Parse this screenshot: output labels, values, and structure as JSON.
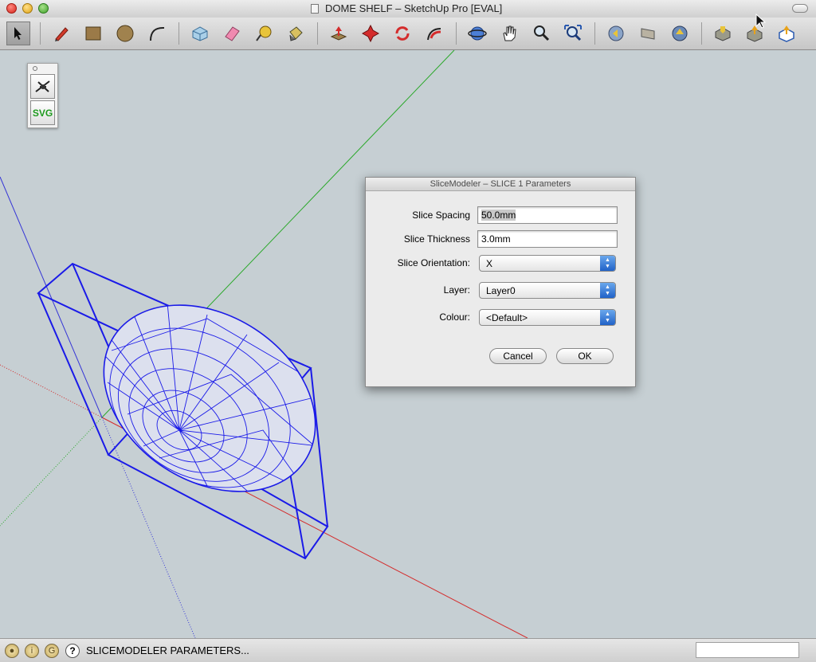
{
  "window": {
    "title": "DOME SHELF – SketchUp Pro [EVAL]"
  },
  "toolbar": {
    "tools": [
      "select",
      "pencil",
      "rectangle",
      "circle",
      "arc",
      "make-component",
      "eraser",
      "tape-measure",
      "paint-bucket",
      "push-pull",
      "move",
      "rotate",
      "follow-me",
      "orbit",
      "pan",
      "zoom",
      "zoom-extents",
      "previous-view",
      "next-view",
      "standard-views",
      "materials-view",
      "components-view",
      "share-view"
    ]
  },
  "palette": {
    "svg_label": "SVG"
  },
  "dialog": {
    "title": "SliceModeler – SLICE 1 Parameters",
    "fields": {
      "slice_spacing_label": "Slice Spacing",
      "slice_spacing_value": "50.0mm",
      "slice_thickness_label": "Slice Thickness",
      "slice_thickness_value": "3.0mm",
      "orientation_label": "Slice Orientation:",
      "orientation_value": "X",
      "layer_label": "Layer:",
      "layer_value": "Layer0",
      "colour_label": "Colour:",
      "colour_value": "<Default>"
    },
    "cancel_label": "Cancel",
    "ok_label": "OK"
  },
  "statusbar": {
    "help_glyph": "?",
    "message": "SLICEMODELER PARAMETERS..."
  },
  "colors": {
    "axis_red": "#d42c2c",
    "axis_green": "#29a829",
    "axis_blue": "#3434d6",
    "model_wire": "#1a1ae8",
    "background": "#c6cfd3"
  }
}
